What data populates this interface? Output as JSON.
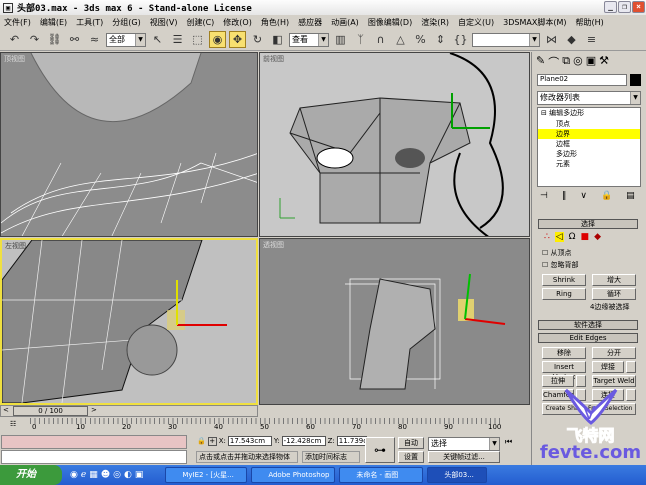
{
  "window": {
    "title": "头部03.max - 3ds max 6 - Stand-alone License",
    "min": "_",
    "max": "❐",
    "close": "×"
  },
  "menu": [
    "文件(F)",
    "编辑(E)",
    "工具(T)",
    "分组(G)",
    "视图(V)",
    "创建(C)",
    "修改(O)",
    "角色(H)",
    "感应器",
    "动画(A)",
    "图像编辑(D)",
    "渲染(R)",
    "自定义(U)",
    "3DSMAX脚本(M)",
    "帮助(H)"
  ],
  "toolbar": {
    "selection_filter": "全部",
    "ref_coord": "查看",
    "named_sel": ""
  },
  "viewports": {
    "top": "顶视图",
    "front": "前视图",
    "left": "左视图",
    "perspective": "透视图"
  },
  "command_panel": {
    "object_name": "Plane02",
    "modifier_list": "修改器列表",
    "stack": {
      "root": "编辑多边形",
      "items": [
        "顶点",
        "边界",
        "边框",
        "多边形",
        "元素"
      ],
      "selected": "边界"
    },
    "selection_title": "选择",
    "by_vertex": "从顶点",
    "ignore_backfacing": "忽略背部",
    "shrink": "Shrink",
    "grow": "增大",
    "ring": "Ring",
    "loop": "循环",
    "selected_info": "4边缘被选择",
    "soft_selection": "软件选择",
    "edit_edges": "Edit Edges",
    "remove": "移除",
    "split": "分开",
    "insert_vertex": "Insert Vertex",
    "weld": "焊接",
    "extrude": "拉伸",
    "target_weld": "Target Weld",
    "chamfer": "Chamfer",
    "connect": "连接",
    "create_shape": "Create Shape From Selection"
  },
  "timeline": {
    "frame": "0 / 100",
    "prev": "<",
    "next": ">",
    "ticks": [
      "0",
      "10",
      "20",
      "30",
      "40",
      "50",
      "60",
      "70",
      "80",
      "90",
      "100"
    ]
  },
  "status": {
    "x": "17.543cm",
    "y": "-12.428cm",
    "z": "11.739cm",
    "x_label": "X:",
    "y_label": "Y:",
    "z_label": "Z:",
    "auto_key": "自动",
    "set_key": "设置",
    "key_mode": "选择",
    "key_filters": "关键帧过滤...",
    "prompt": "点击或点击并拖动来选择物体",
    "add_time_tag": "添加时间标志"
  },
  "taskbar": {
    "start": "开始",
    "tasks": [
      "MyIE2 - [火星...",
      "Adobe Photoshop",
      "未命名 - 画图",
      "头部03..."
    ]
  },
  "watermark": {
    "cn": "飞特网",
    "en": "fevte.com"
  },
  "colors": {
    "viewport_bg": "#8c8c8c",
    "active_border": "#f0e040",
    "highlight": "#ffff00",
    "taskbar": "#245dd0"
  }
}
